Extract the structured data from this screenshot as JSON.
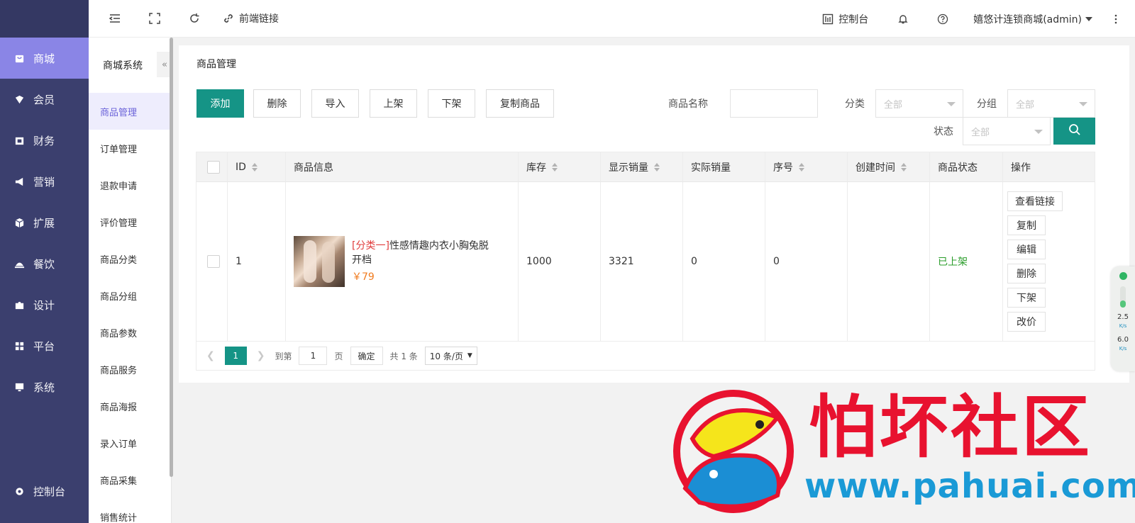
{
  "leftnav": {
    "items": [
      {
        "label": "商城",
        "icon": "shop-icon"
      },
      {
        "label": "会员",
        "icon": "member-icon"
      },
      {
        "label": "财务",
        "icon": "wallet-icon"
      },
      {
        "label": "营销",
        "icon": "megaphone-icon"
      },
      {
        "label": "扩展",
        "icon": "cube-icon"
      },
      {
        "label": "餐饮",
        "icon": "dish-icon"
      },
      {
        "label": "设计",
        "icon": "puzzle-icon"
      },
      {
        "label": "平台",
        "icon": "grid-icon"
      },
      {
        "label": "系统",
        "icon": "monitor-icon"
      }
    ],
    "bottom_label": "控制台"
  },
  "topbar": {
    "frontend_link": "前端链接",
    "console": "控制台",
    "user": "嬉悠计连锁商城(admin)"
  },
  "submenu": {
    "title": "商城系统",
    "collapse": "«",
    "items": [
      "商品管理",
      "订单管理",
      "退款申请",
      "评价管理",
      "商品分类",
      "商品分组",
      "商品参数",
      "商品服务",
      "商品海报",
      "录入订单",
      "商品采集",
      "销售统计"
    ]
  },
  "panel": {
    "title": "商品管理",
    "buttons": {
      "add": "添加",
      "delete": "删除",
      "import": "导入",
      "list": "上架",
      "delist": "下架",
      "copy": "复制商品"
    },
    "filters": {
      "name_label": "商品名称",
      "category_label": "分类",
      "category_value": "全部",
      "group_label": "分组",
      "group_value": "全部",
      "status_label": "状态",
      "status_value": "全部"
    }
  },
  "table": {
    "headers": [
      "ID",
      "商品信息",
      "库存",
      "显示销量",
      "实际销量",
      "序号",
      "创建时间",
      "商品状态",
      "操作"
    ],
    "rows": [
      {
        "id": "1",
        "category": "[分类一]",
        "name": "性感情趣内衣小胸兔脱开档",
        "price": "￥79",
        "stock": "1000",
        "display_sales": "3321",
        "actual_sales": "0",
        "order": "0",
        "created": "",
        "status": "已上架",
        "ops": [
          "查看链接",
          "复制",
          "编辑",
          "删除",
          "下架",
          "改价"
        ]
      }
    ]
  },
  "pager": {
    "current": "1",
    "goto_label": "到第",
    "page_input": "1",
    "page_unit": "页",
    "confirm": "确定",
    "total": "共 1 条",
    "page_size": "10 条/页"
  },
  "speed_widget": {
    "up": "2.5",
    "down": "6.0",
    "unit": "K/s"
  },
  "watermark": {
    "title": "怕坏社区",
    "url": "www.pahuai.com"
  },
  "colors": {
    "primary": "#159486",
    "nav_bg": "#3b3f6e",
    "nav_active": "#8a85e6",
    "danger": "#e03d3d",
    "price": "#f07b1f",
    "status_ok": "#2a9d2a"
  }
}
